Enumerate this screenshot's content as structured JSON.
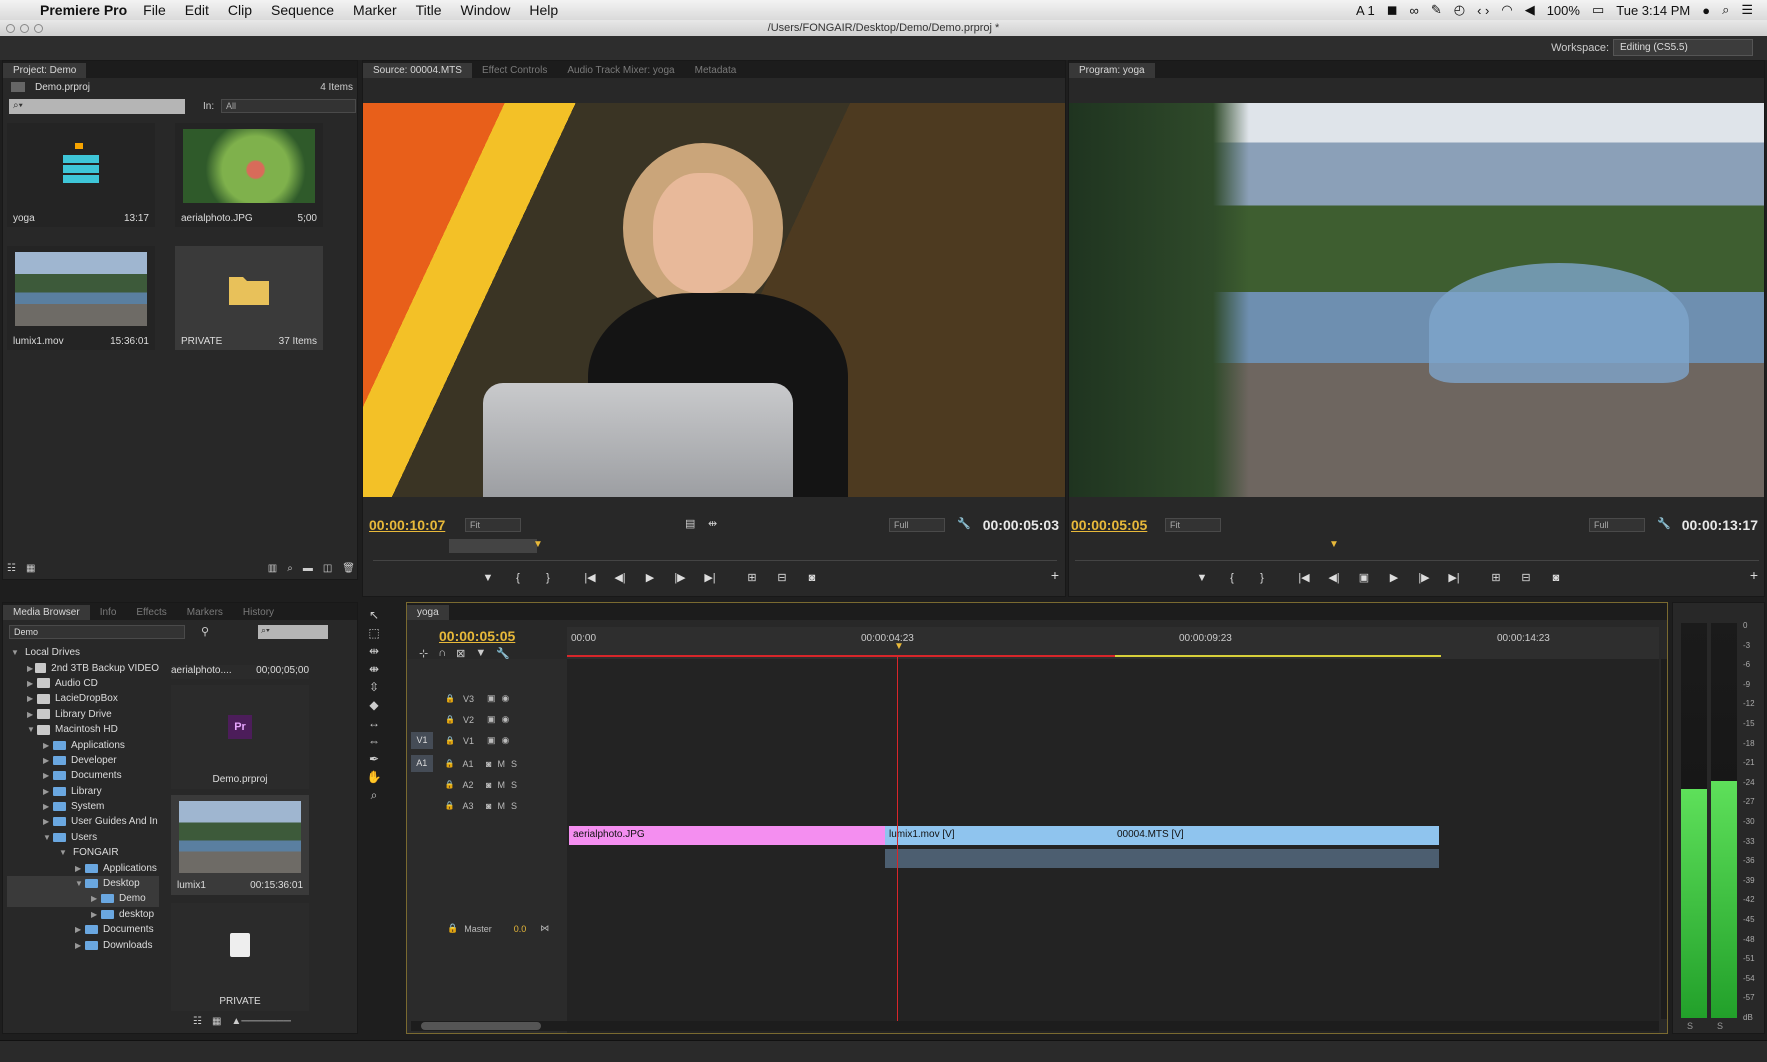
{
  "menubar": {
    "app": "Premiere Pro",
    "items": [
      "File",
      "Edit",
      "Clip",
      "Sequence",
      "Marker",
      "Title",
      "Window",
      "Help"
    ],
    "right": {
      "adobe": "A 1",
      "battery": "100%",
      "clock": "Tue 3:14 PM"
    }
  },
  "window": {
    "path": "/Users/FONGAIR/Desktop/Demo/Demo.prproj *"
  },
  "workspace": {
    "label": "Workspace:",
    "value": "Editing (CS5.5)"
  },
  "project": {
    "tab": "Project: Demo",
    "file": "Demo.prproj",
    "count": "4 Items",
    "in_label": "In:",
    "in_value": "All",
    "bins": [
      {
        "name": "yoga",
        "dur": "13:17"
      },
      {
        "name": "aerialphoto.JPG",
        "dur": "5;00"
      },
      {
        "name": "lumix1.mov",
        "dur": "15:36:01"
      },
      {
        "name": "PRIVATE",
        "dur": "37 Items"
      }
    ]
  },
  "source": {
    "tabs": [
      "Source: 00004.MTS",
      "Effect Controls",
      "Audio Track Mixer: yoga",
      "Metadata"
    ],
    "tc_in": "00:00:10:07",
    "fit": "Fit",
    "quality": "Full",
    "tc_dur": "00:00:05:03"
  },
  "program": {
    "tab": "Program: yoga",
    "tc_in": "00:00:05:05",
    "fit": "Fit",
    "quality": "Full",
    "tc_dur": "00:00:13:17"
  },
  "mediabrowser": {
    "tabs": [
      "Media Browser",
      "Info",
      "Effects",
      "Markers",
      "History"
    ],
    "location": "Demo",
    "tree": [
      {
        "label": "Local Drives",
        "lvl": 0,
        "t": "h"
      },
      {
        "label": "2nd 3TB Backup VIDEO",
        "lvl": 1,
        "t": "d"
      },
      {
        "label": "Audio CD",
        "lvl": 1,
        "t": "d"
      },
      {
        "label": "LacieDropBox",
        "lvl": 1,
        "t": "d"
      },
      {
        "label": "Library Drive",
        "lvl": 1,
        "t": "d"
      },
      {
        "label": "Macintosh HD",
        "lvl": 1,
        "t": "d"
      },
      {
        "label": "Applications",
        "lvl": 2,
        "t": "f"
      },
      {
        "label": "Developer",
        "lvl": 2,
        "t": "f"
      },
      {
        "label": "Documents",
        "lvl": 2,
        "t": "f"
      },
      {
        "label": "Library",
        "lvl": 2,
        "t": "f"
      },
      {
        "label": "System",
        "lvl": 2,
        "t": "f"
      },
      {
        "label": "User Guides And In",
        "lvl": 2,
        "t": "f"
      },
      {
        "label": "Users",
        "lvl": 2,
        "t": "f"
      },
      {
        "label": "FONGAIR",
        "lvl": 3,
        "t": "h"
      },
      {
        "label": "Applications",
        "lvl": 4,
        "t": "f"
      },
      {
        "label": "Desktop",
        "lvl": 4,
        "t": "f"
      },
      {
        "label": "Demo",
        "lvl": 5,
        "t": "f"
      },
      {
        "label": "desktop",
        "lvl": 5,
        "t": "f"
      },
      {
        "label": "Documents",
        "lvl": 4,
        "t": "f"
      },
      {
        "label": "Downloads",
        "lvl": 4,
        "t": "f"
      }
    ],
    "items": [
      {
        "name": "aerialphoto....",
        "dur": "00;00;05;00"
      },
      {
        "name": "Demo.prproj",
        "dur": ""
      },
      {
        "name": "lumix1",
        "dur": "00:15:36:01"
      },
      {
        "name": "PRIVATE",
        "dur": ""
      }
    ]
  },
  "timeline": {
    "tab": "yoga",
    "tc": "00:00:05:05",
    "ruler": [
      "00:00",
      "00:00:04:23",
      "00:00:09:23",
      "00:00:14:23"
    ],
    "tracks": [
      {
        "src": "",
        "name": "V3"
      },
      {
        "src": "",
        "name": "V2"
      },
      {
        "src": "V1",
        "name": "V1"
      },
      {
        "src": "A1",
        "name": "A1"
      },
      {
        "src": "",
        "name": "A2"
      },
      {
        "src": "",
        "name": "A3"
      }
    ],
    "master": {
      "name": "Master",
      "value": "0.0"
    },
    "clips": [
      {
        "label": "aerialphoto.JPG",
        "color": "#f48ef0"
      },
      {
        "label": "lumix1.mov [V]",
        "color": "#8fc4ee"
      },
      {
        "label": "00004.MTS [V]",
        "color": "#8fc4ee"
      }
    ]
  },
  "meters": {
    "ticks": [
      "0",
      "-3",
      "-6",
      "-9",
      "-12",
      "-15",
      "-18",
      "-21",
      "-24",
      "-27",
      "-30",
      "-33",
      "-36",
      "-39",
      "-42",
      "-45",
      "-48",
      "-51",
      "-54",
      "-57",
      "dB"
    ],
    "levels": [
      0.58,
      0.6
    ]
  }
}
